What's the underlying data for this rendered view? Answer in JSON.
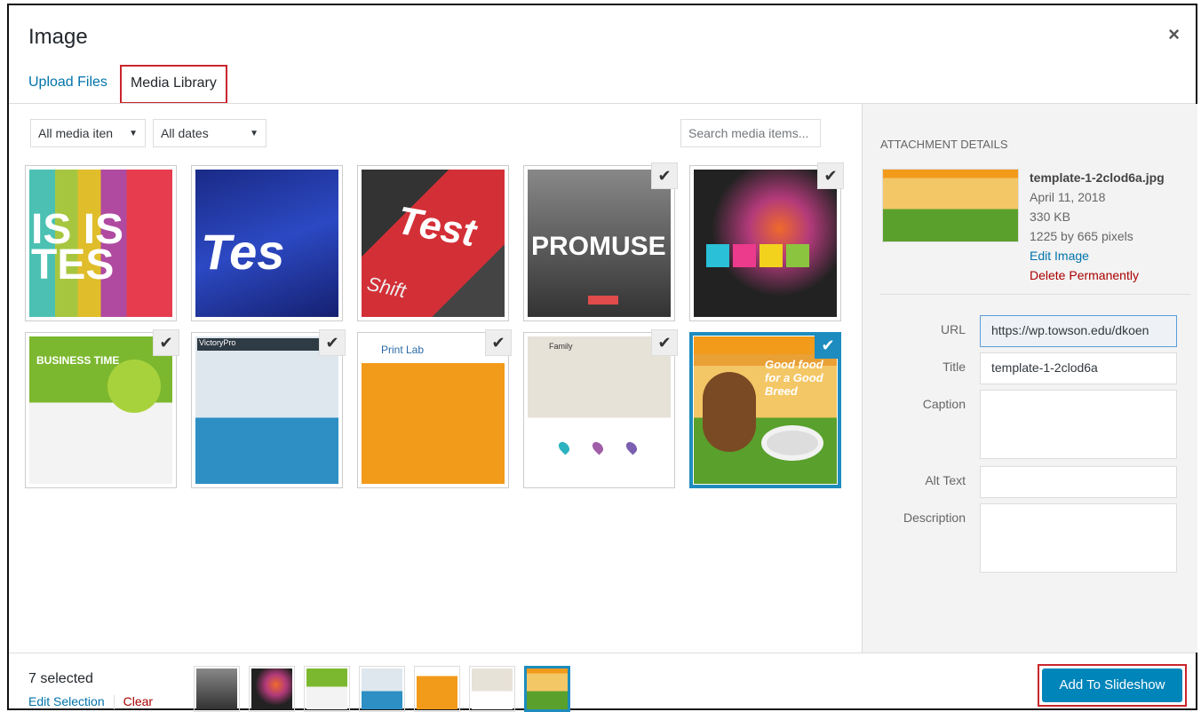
{
  "modal": {
    "title": "Image",
    "close": "×",
    "tabs": [
      "Upload Files",
      "Media Library"
    ]
  },
  "toolbar": {
    "filter_type": "All media iten",
    "filter_dates": "All dates",
    "caret": "▼",
    "search_placeholder": "Search media items..."
  },
  "grid": {
    "items": [
      {
        "label": "IS IS TES",
        "selected": false
      },
      {
        "label": "Tes",
        "selected": false
      },
      {
        "label": "Test",
        "sublabel": "Shift",
        "selected": false
      },
      {
        "label": "PROMUSE",
        "selected": true
      },
      {
        "label": "",
        "selected": true
      },
      {
        "label": "BUSINESS TIME",
        "selected": true
      },
      {
        "label": "VictoryPro",
        "selected": true
      },
      {
        "label": "Print Lab",
        "selected": true
      },
      {
        "label": "Family",
        "selected": true
      },
      {
        "label": "Good food for a Good Breed",
        "selected": true,
        "active": true
      }
    ],
    "check": "✔"
  },
  "details": {
    "heading": "ATTACHMENT DETAILS",
    "filename": "template-1-2clod6a.jpg",
    "date": "April 11, 2018",
    "size": "330 KB",
    "dimensions": "1225 by 665 pixels",
    "edit": "Edit Image",
    "delete": "Delete Permanently",
    "fields": {
      "url_label": "URL",
      "url_value": "https://wp.towson.edu/dkoen",
      "title_label": "Title",
      "title_value": "template-1-2clod6a",
      "caption_label": "Caption",
      "alt_label": "Alt Text",
      "description_label": "Description"
    }
  },
  "footer": {
    "count": "7 selected",
    "edit_selection": "Edit Selection",
    "clear": "Clear",
    "button": "Add To Slideshow"
  },
  "colors": {
    "accent": "#0085ba",
    "selection": "#1e8cbe",
    "highlight_box": "#c9252c"
  }
}
